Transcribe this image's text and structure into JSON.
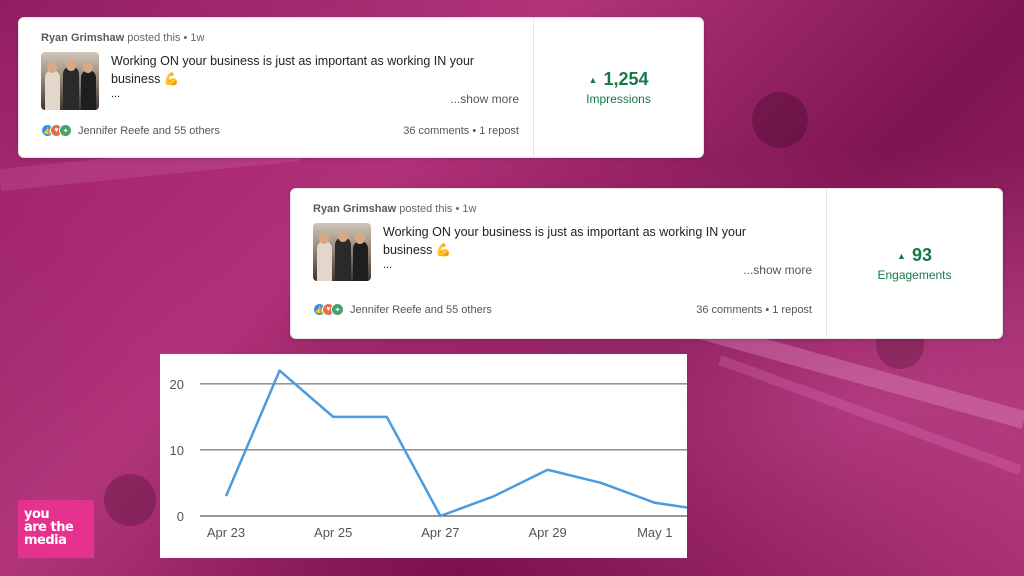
{
  "posts": [
    {
      "author": "Ryan Grimshaw",
      "meta_suffix": "posted this • 1w",
      "text_line1": "Working ON your business is just as important as working IN your",
      "text_line2": "business 💪",
      "text_line3": "...",
      "show_more": "...show more",
      "reactors": "Jennifer Reefe and 55 others",
      "stats": "36 comments • 1 repost",
      "metric_arrow": "▲",
      "metric_value": "1,254",
      "metric_label": "Impressions"
    },
    {
      "author": "Ryan Grimshaw",
      "meta_suffix": "posted this • 1w",
      "text_line1": "Working ON your business is just as important as working IN your",
      "text_line2": "business 💪",
      "text_line3": "...",
      "show_more": "...show more",
      "reactors": "Jennifer Reefe and 55 others",
      "stats": "36 comments • 1 repost",
      "metric_arrow": "▲",
      "metric_value": "93",
      "metric_label": "Engagements"
    }
  ],
  "chart_data": {
    "type": "line",
    "x": [
      "Apr 23",
      "Apr 24",
      "Apr 25",
      "Apr 26",
      "Apr 27",
      "Apr 28",
      "Apr 29",
      "Apr 30",
      "May 1",
      "May 2"
    ],
    "series": [
      {
        "values": [
          3,
          22,
          15,
          15,
          0,
          3,
          7,
          5,
          2,
          0.8
        ]
      }
    ],
    "x_tick_labels": [
      "Apr 23",
      "Apr 25",
      "Apr 27",
      "Apr 29",
      "May 1"
    ],
    "y_ticks": [
      0,
      10,
      20
    ],
    "ylim": [
      0,
      23
    ],
    "grid": true,
    "title": "",
    "xlabel": "",
    "ylabel": "",
    "line_color": "#4a9be0"
  },
  "logo": {
    "line1": "you",
    "line2": "are the",
    "line3": "media"
  },
  "colors": {
    "metric_green": "#157a4a",
    "logo_pink": "#e5328f"
  }
}
